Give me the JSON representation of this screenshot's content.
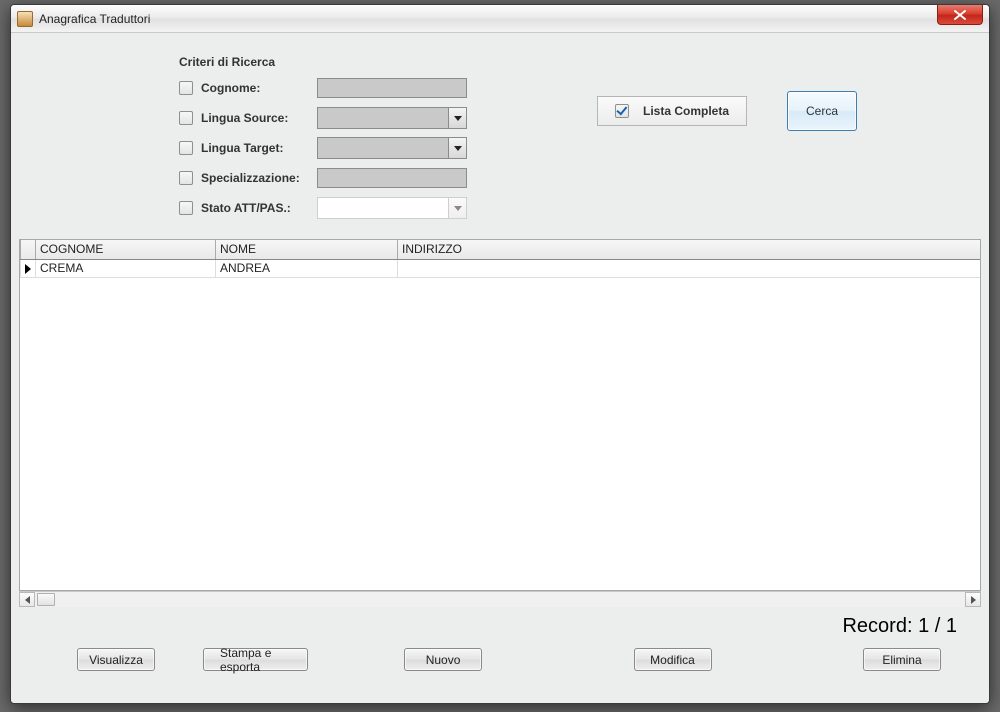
{
  "window": {
    "title": "Anagrafica Traduttori"
  },
  "criteria": {
    "group_title": "Criteri di Ricerca",
    "cognome_label": "Cognome:",
    "lingua_source_label": "Lingua Source:",
    "lingua_target_label": "Lingua Target:",
    "specializzazione_label": "Specializzazione:",
    "stato_label": "Stato ATT/PAS.:",
    "lista_completa_label": "Lista Completa",
    "cerca_label": "Cerca"
  },
  "grid": {
    "columns": {
      "cognome": "COGNOME",
      "nome": "NOME",
      "indirizzo": "INDIRIZZO"
    },
    "rows": [
      {
        "cognome": "CREMA",
        "nome": "ANDREA",
        "indirizzo": ""
      }
    ]
  },
  "footer": {
    "record_label": "Record: 1 / 1",
    "visualizza": "Visualizza",
    "stampa": "Stampa e esporta",
    "nuovo": "Nuovo",
    "modifica": "Modifica",
    "elimina": "Elimina"
  }
}
